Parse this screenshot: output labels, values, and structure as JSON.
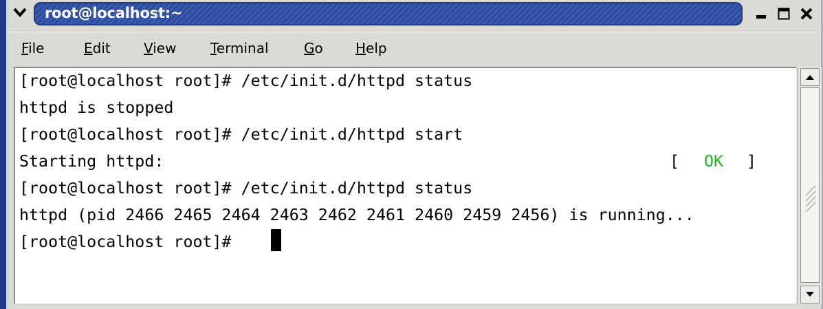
{
  "window": {
    "title": "root@localhost:~",
    "accent_color": "#2e4d9e",
    "frame_color": "#213a8c"
  },
  "icons": {
    "window_menu": "chevron-down-icon",
    "minimize": "minimize-icon",
    "maximize": "maximize-icon",
    "close": "close-icon"
  },
  "menu": {
    "file": {
      "mnemonic": "F",
      "rest": "ile"
    },
    "edit": {
      "mnemonic": "E",
      "rest": "dit"
    },
    "view": {
      "mnemonic": "V",
      "rest": "iew"
    },
    "terminal": {
      "mnemonic": "T",
      "rest": "erminal"
    },
    "go": {
      "mnemonic": "G",
      "rest": "o"
    },
    "help": {
      "mnemonic": "H",
      "rest": "elp"
    }
  },
  "terminal": {
    "lines": [
      "[root@localhost root]# /etc/init.d/httpd status",
      "httpd is stopped",
      "[root@localhost root]# /etc/init.d/httpd start",
      "Starting httpd:",
      "[root@localhost root]# /etc/init.d/httpd status",
      "httpd (pid 2466 2465 2464 2463 2462 2461 2460 2459 2456) is running...",
      "[root@localhost root]#"
    ],
    "ok_open": "[",
    "ok_text": "OK",
    "ok_close": "]",
    "ok_color": "#22b822",
    "cursor_color": "#000000"
  }
}
